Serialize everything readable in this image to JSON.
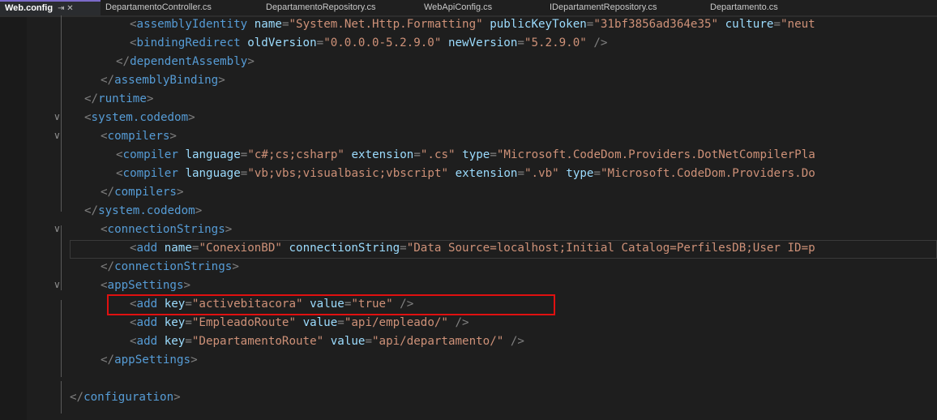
{
  "tabs": [
    {
      "label": "Web.config",
      "extra": "⇥ ✕",
      "active": true
    },
    {
      "label": "DepartamentoController.cs",
      "active": false
    },
    {
      "label": "DepartamentoRepository.cs",
      "active": false
    },
    {
      "label": "WebApiConfig.cs",
      "active": false
    },
    {
      "label": "IDepartamentRepository.cs",
      "active": false
    },
    {
      "label": "Departamento.cs",
      "active": false
    }
  ],
  "code_lines": [
    {
      "indent": 160,
      "tokens": [
        [
          "b",
          "<"
        ],
        [
          "t",
          "assemblyIdentity"
        ],
        [
          "p",
          " "
        ],
        [
          "a",
          "name"
        ],
        [
          "b",
          "="
        ],
        [
          "v",
          "\"System.Net.Http.Formatting\""
        ],
        [
          "p",
          " "
        ],
        [
          "a",
          "publicKeyToken"
        ],
        [
          "b",
          "="
        ],
        [
          "v",
          "\"31bf3856ad364e35\""
        ],
        [
          "p",
          " "
        ],
        [
          "a",
          "culture"
        ],
        [
          "b",
          "="
        ],
        [
          "v",
          "\"neut"
        ]
      ]
    },
    {
      "indent": 160,
      "tokens": [
        [
          "b",
          "<"
        ],
        [
          "t",
          "bindingRedirect"
        ],
        [
          "p",
          " "
        ],
        [
          "a",
          "oldVersion"
        ],
        [
          "b",
          "="
        ],
        [
          "v",
          "\"0.0.0.0-5.2.9.0\""
        ],
        [
          "p",
          " "
        ],
        [
          "a",
          "newVersion"
        ],
        [
          "b",
          "="
        ],
        [
          "v",
          "\"5.2.9.0\""
        ],
        [
          "p",
          " "
        ],
        [
          "b",
          "/>"
        ]
      ]
    },
    {
      "indent": 143,
      "tokens": [
        [
          "b",
          "</"
        ],
        [
          "t",
          "dependentAssembly"
        ],
        [
          "b",
          ">"
        ]
      ]
    },
    {
      "indent": 124,
      "tokens": [
        [
          "b",
          "</"
        ],
        [
          "t",
          "assemblyBinding"
        ],
        [
          "b",
          ">"
        ]
      ]
    },
    {
      "indent": 104,
      "tokens": [
        [
          "b",
          "</"
        ],
        [
          "t",
          "runtime"
        ],
        [
          "b",
          ">"
        ]
      ]
    },
    {
      "indent": 104,
      "tokens": [
        [
          "b",
          "<"
        ],
        [
          "t",
          "system.codedom"
        ],
        [
          "b",
          ">"
        ]
      ]
    },
    {
      "indent": 124,
      "tokens": [
        [
          "b",
          "<"
        ],
        [
          "t",
          "compilers"
        ],
        [
          "b",
          ">"
        ]
      ]
    },
    {
      "indent": 143,
      "tokens": [
        [
          "b",
          "<"
        ],
        [
          "t",
          "compiler"
        ],
        [
          "p",
          " "
        ],
        [
          "a",
          "language"
        ],
        [
          "b",
          "="
        ],
        [
          "v",
          "\"c#;cs;csharp\""
        ],
        [
          "p",
          " "
        ],
        [
          "a",
          "extension"
        ],
        [
          "b",
          "="
        ],
        [
          "v",
          "\".cs\""
        ],
        [
          "p",
          " "
        ],
        [
          "a",
          "type"
        ],
        [
          "b",
          "="
        ],
        [
          "v",
          "\"Microsoft.CodeDom.Providers.DotNetCompilerPla"
        ]
      ]
    },
    {
      "indent": 143,
      "tokens": [
        [
          "b",
          "<"
        ],
        [
          "t",
          "compiler"
        ],
        [
          "p",
          " "
        ],
        [
          "a",
          "language"
        ],
        [
          "b",
          "="
        ],
        [
          "v",
          "\"vb;vbs;visualbasic;vbscript\""
        ],
        [
          "p",
          " "
        ],
        [
          "a",
          "extension"
        ],
        [
          "b",
          "="
        ],
        [
          "v",
          "\".vb\""
        ],
        [
          "p",
          " "
        ],
        [
          "a",
          "type"
        ],
        [
          "b",
          "="
        ],
        [
          "v",
          "\"Microsoft.CodeDom.Providers.Do"
        ]
      ]
    },
    {
      "indent": 124,
      "tokens": [
        [
          "b",
          "</"
        ],
        [
          "t",
          "compilers"
        ],
        [
          "b",
          ">"
        ]
      ]
    },
    {
      "indent": 104,
      "tokens": [
        [
          "b",
          "</"
        ],
        [
          "t",
          "system.codedom"
        ],
        [
          "b",
          ">"
        ]
      ]
    },
    {
      "indent": 124,
      "tokens": [
        [
          "b",
          "<"
        ],
        [
          "t",
          "connectionStrings"
        ],
        [
          "b",
          ">"
        ]
      ]
    },
    {
      "indent": 160,
      "tokens": [
        [
          "b",
          "<"
        ],
        [
          "t",
          "add"
        ],
        [
          "p",
          " "
        ],
        [
          "a",
          "name"
        ],
        [
          "b",
          "="
        ],
        [
          "v",
          "\"ConexionBD\""
        ],
        [
          "p",
          " "
        ],
        [
          "a",
          "connectionString"
        ],
        [
          "b",
          "="
        ],
        [
          "v",
          "\"Data Source=localhost;Initial Catalog=PerfilesDB;User ID=p"
        ]
      ]
    },
    {
      "indent": 124,
      "tokens": [
        [
          "b",
          "</"
        ],
        [
          "t",
          "connectionStrings"
        ],
        [
          "b",
          ">"
        ]
      ]
    },
    {
      "indent": 124,
      "tokens": [
        [
          "b",
          "<"
        ],
        [
          "t",
          "appSettings"
        ],
        [
          "b",
          ">"
        ]
      ]
    },
    {
      "indent": 160,
      "tokens": [
        [
          "b",
          "<"
        ],
        [
          "t",
          "add"
        ],
        [
          "p",
          " "
        ],
        [
          "a",
          "key"
        ],
        [
          "b",
          "="
        ],
        [
          "v",
          "\"activebitacora\""
        ],
        [
          "p",
          " "
        ],
        [
          "a",
          "value"
        ],
        [
          "b",
          "="
        ],
        [
          "v",
          "\"true\""
        ],
        [
          "p",
          " "
        ],
        [
          "b",
          "/>"
        ]
      ]
    },
    {
      "indent": 160,
      "tokens": [
        [
          "b",
          "<"
        ],
        [
          "t",
          "add"
        ],
        [
          "p",
          " "
        ],
        [
          "a",
          "key"
        ],
        [
          "b",
          "="
        ],
        [
          "v",
          "\"EmpleadoRoute\""
        ],
        [
          "p",
          " "
        ],
        [
          "a",
          "value"
        ],
        [
          "b",
          "="
        ],
        [
          "v",
          "\"api/empleado/\""
        ],
        [
          "p",
          " "
        ],
        [
          "b",
          "/>"
        ]
      ]
    },
    {
      "indent": 160,
      "tokens": [
        [
          "b",
          "<"
        ],
        [
          "t",
          "add"
        ],
        [
          "p",
          " "
        ],
        [
          "a",
          "key"
        ],
        [
          "b",
          "="
        ],
        [
          "v",
          "\"DepartamentoRoute\""
        ],
        [
          "p",
          " "
        ],
        [
          "a",
          "value"
        ],
        [
          "b",
          "="
        ],
        [
          "v",
          "\"api/departamento/\""
        ],
        [
          "p",
          " "
        ],
        [
          "b",
          "/>"
        ]
      ]
    },
    {
      "indent": 124,
      "tokens": [
        [
          "b",
          "</"
        ],
        [
          "t",
          "appSettings"
        ],
        [
          "b",
          ">"
        ]
      ]
    },
    {
      "indent": 104,
      "tokens": []
    },
    {
      "indent": 86,
      "tokens": [
        [
          "b",
          "</"
        ],
        [
          "t",
          "configuration"
        ],
        [
          "b",
          ">"
        ]
      ]
    }
  ],
  "colors": {
    "tag": "#569cd6",
    "attribute": "#9cdcfe",
    "string": "#ce9178",
    "bracket": "#808080",
    "highlight_box": "#e01010"
  },
  "icons": {
    "collapse": "chevron-down-icon",
    "pin": "pin-icon",
    "close": "close-icon"
  }
}
